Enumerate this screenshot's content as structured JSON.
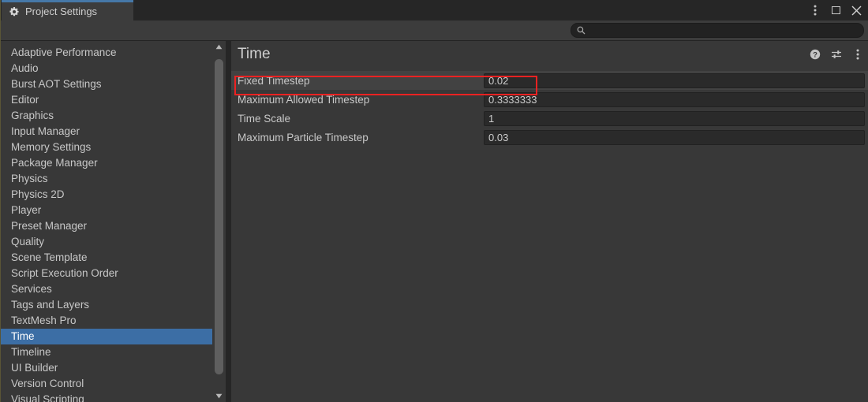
{
  "window": {
    "tab_label": "Project Settings",
    "tab_icon": "gear-icon",
    "controls": {
      "menu": "kebab-menu-icon",
      "maximize": "maximize-icon",
      "close": "close-icon"
    }
  },
  "search": {
    "value": "",
    "placeholder": "",
    "icon": "search-icon"
  },
  "sidebar": {
    "items": [
      {
        "label": "Adaptive Performance",
        "selected": false
      },
      {
        "label": "Audio",
        "selected": false
      },
      {
        "label": "Burst AOT Settings",
        "selected": false
      },
      {
        "label": "Editor",
        "selected": false
      },
      {
        "label": "Graphics",
        "selected": false
      },
      {
        "label": "Input Manager",
        "selected": false
      },
      {
        "label": "Memory Settings",
        "selected": false
      },
      {
        "label": "Package Manager",
        "selected": false
      },
      {
        "label": "Physics",
        "selected": false
      },
      {
        "label": "Physics 2D",
        "selected": false
      },
      {
        "label": "Player",
        "selected": false
      },
      {
        "label": "Preset Manager",
        "selected": false
      },
      {
        "label": "Quality",
        "selected": false
      },
      {
        "label": "Scene Template",
        "selected": false
      },
      {
        "label": "Script Execution Order",
        "selected": false
      },
      {
        "label": "Services",
        "selected": false
      },
      {
        "label": "Tags and Layers",
        "selected": false
      },
      {
        "label": "TextMesh Pro",
        "selected": false
      },
      {
        "label": "Time",
        "selected": true
      },
      {
        "label": "Timeline",
        "selected": false
      },
      {
        "label": "UI Builder",
        "selected": false
      },
      {
        "label": "Version Control",
        "selected": false
      },
      {
        "label": "Visual Scripting",
        "selected": false
      }
    ],
    "scrollbar": {
      "up_arrow": "scroll-up-arrow-icon",
      "down_arrow": "scroll-down-arrow-icon"
    }
  },
  "content": {
    "title": "Time",
    "header_icons": [
      {
        "name": "help-icon"
      },
      {
        "name": "preset-icon"
      },
      {
        "name": "kebab-menu-icon"
      }
    ],
    "properties": [
      {
        "label": "Fixed Timestep",
        "value": "0.02",
        "highlighted": true
      },
      {
        "label": "Maximum Allowed Timestep",
        "value": "0.3333333",
        "highlighted": false
      },
      {
        "label": "Time Scale",
        "value": "1",
        "highlighted": false
      },
      {
        "label": "Maximum Particle Timestep",
        "value": "0.03",
        "highlighted": false
      }
    ]
  },
  "annotation": {
    "color": "#ee2222",
    "target": "Fixed Timestep"
  },
  "colors": {
    "window_bg": "#262626",
    "panel_bg": "#383838",
    "toolbar_bg": "#3c3c3c",
    "field_bg": "#2a2a2a",
    "selection_blue": "#3c6ea5",
    "tab_accent": "#4678a8",
    "text": "#c8c8c8",
    "annotation_red": "#ee2222"
  }
}
